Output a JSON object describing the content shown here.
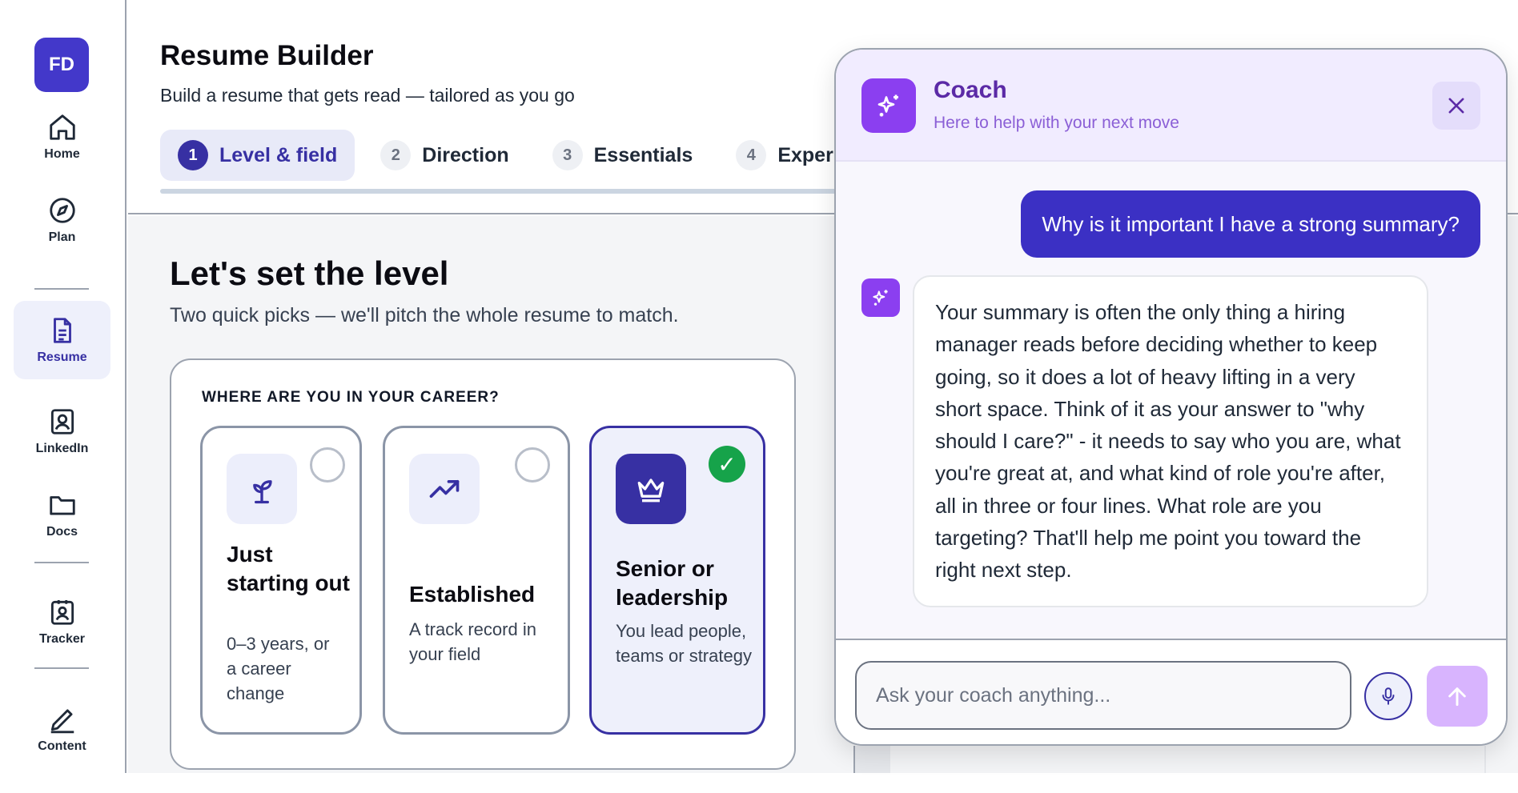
{
  "user": {
    "initials": "FD"
  },
  "sidebar": {
    "items": [
      {
        "label": "Home",
        "icon": "home-icon"
      },
      {
        "label": "Plan",
        "icon": "compass-icon"
      },
      {
        "label": "Resume",
        "icon": "document-icon",
        "active": true
      },
      {
        "label": "LinkedIn",
        "icon": "profile-card-icon"
      },
      {
        "label": "Docs",
        "icon": "folder-icon"
      },
      {
        "label": "Tracker",
        "icon": "badge-icon"
      },
      {
        "label": "Content",
        "icon": "pen-icon"
      }
    ]
  },
  "header": {
    "title": "Resume Builder",
    "subtitle": "Build a resume that gets read — tailored as you go",
    "steps": [
      {
        "num": "1",
        "label": "Level & field",
        "active": true
      },
      {
        "num": "2",
        "label": "Direction"
      },
      {
        "num": "3",
        "label": "Essentials"
      },
      {
        "num": "4",
        "label": "Experience"
      }
    ]
  },
  "main": {
    "title": "Let's set the level",
    "subtitle": "Two quick picks — we'll pitch the whole resume to match.",
    "section_label": "WHERE ARE YOU IN YOUR CAREER?",
    "options": [
      {
        "title": "Just starting out",
        "desc": "0–3 years, or a career change",
        "icon": "sprout-icon",
        "selected": false
      },
      {
        "title": "Established",
        "desc": "A track record in your field",
        "icon": "trending-up-icon",
        "selected": false
      },
      {
        "title": "Senior or leadership",
        "desc": "You lead people, teams or strategy",
        "icon": "crown-icon",
        "selected": true
      }
    ],
    "check_glyph": "✓"
  },
  "coach": {
    "title": "Coach",
    "subtitle": "Here to help with your next move",
    "user_message": "Why is it important I have a strong summary?",
    "bot_message": "Your summary is often the only thing a hiring manager reads before deciding whether to keep going, so it does a lot of heavy lifting in a very short space. Think of it as your answer to \"why should I care?\" - it needs to say who you are, what you're great at, and what kind of role you're after, all in three or four lines. What role are you targeting? That'll help me point you toward the right next step.",
    "input_placeholder": "Ask your coach anything...",
    "input_value": ""
  },
  "colors": {
    "accent": "#3730a3",
    "coach_purple": "#8b3ff0",
    "success": "#16a34a",
    "send_disabled": "#d8b4fe"
  }
}
